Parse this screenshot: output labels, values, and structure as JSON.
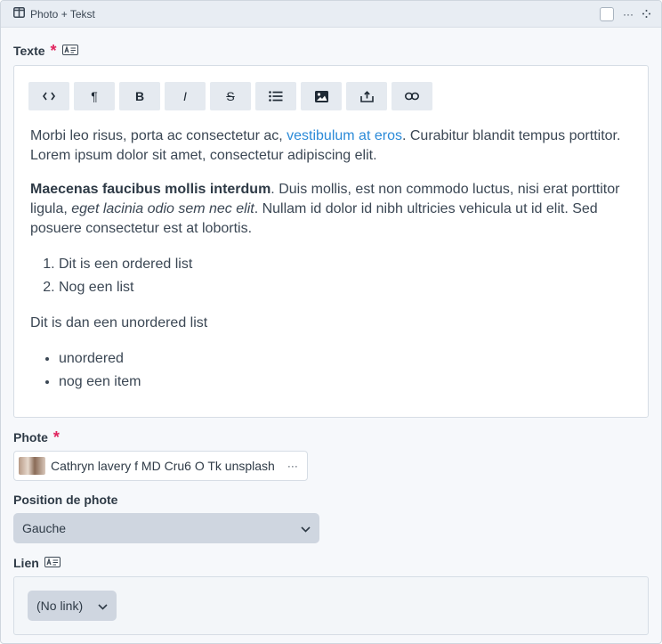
{
  "block": {
    "title": "Photo + Tekst",
    "menu_icon": "more-horizontal-icon",
    "drag_icon": "move-icon"
  },
  "texte": {
    "label": "Texte",
    "required_mark": "*",
    "toolbar": [
      {
        "name": "code",
        "glyph": "<>"
      },
      {
        "name": "paragraph",
        "glyph": "¶"
      },
      {
        "name": "bold",
        "glyph": "B"
      },
      {
        "name": "italic",
        "glyph": "I"
      },
      {
        "name": "strikethrough",
        "glyph": "S"
      },
      {
        "name": "bulleted-list",
        "glyph": "list-icon"
      },
      {
        "name": "image",
        "glyph": "image-icon"
      },
      {
        "name": "upload",
        "glyph": "upload-icon"
      },
      {
        "name": "link",
        "glyph": "link-icon"
      }
    ],
    "p1_before_link": "Morbi leo risus, porta ac consectetur ac, ",
    "p1_link": "vestibulum at eros",
    "p1_after_link": ". Curabitur blandit tempus porttitor. Lorem ipsum dolor sit amet, consectetur adipiscing elit.",
    "p2_bold": "Maecenas faucibus mollis interdum",
    "p2_after_bold": ". Duis mollis, est non commodo luctus, nisi erat porttitor ligula, ",
    "p2_italic": "eget lacinia odio sem nec elit",
    "p2_end": ". Nullam id dolor id nibh ultricies vehicula ut id elit. Sed posuere consectetur est at lobortis.",
    "ordered_list": [
      "Dit is een ordered list",
      "Nog een list"
    ],
    "p3": "Dit is dan een unordered list",
    "unordered_list": [
      "unordered",
      "nog een item"
    ]
  },
  "phote": {
    "label": "Phote",
    "required_mark": "*",
    "file_name": "Cathryn lavery f MD Cru6 O Tk unsplash",
    "menu": "···"
  },
  "position": {
    "label": "Position de phote",
    "selected": "Gauche"
  },
  "lien": {
    "label": "Lien",
    "selected": "(No link)"
  }
}
